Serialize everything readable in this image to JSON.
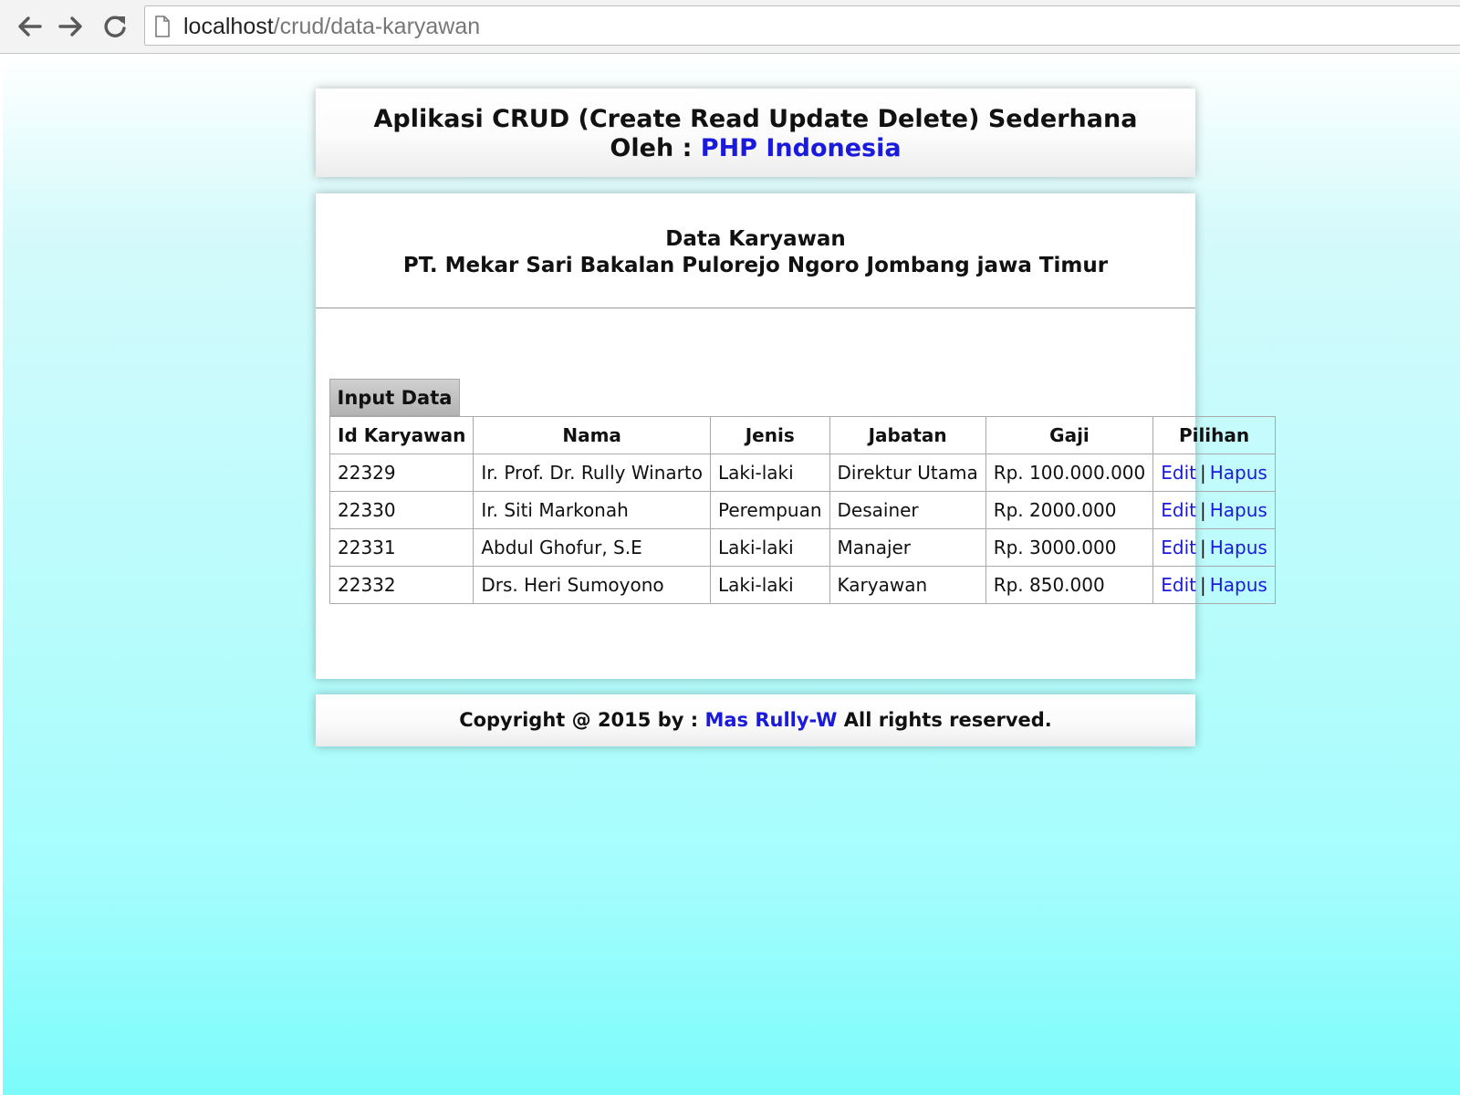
{
  "browser": {
    "url_host": "localhost",
    "url_path": "/crud/data-karyawan",
    "icons": [
      "back-arrow-icon",
      "forward-arrow-icon",
      "reload-icon",
      "page-icon"
    ]
  },
  "header": {
    "title": "Aplikasi CRUD (Create Read Update Delete) Sederhana",
    "by_label": "Oleh :",
    "by_link": "PHP Indonesia"
  },
  "content": {
    "title": "Data Karyawan",
    "subtitle": "PT. Mekar Sari Bakalan Pulorejo Ngoro Jombang jawa Timur",
    "input_button": "Input Data"
  },
  "table": {
    "headers": [
      "Id Karyawan",
      "Nama",
      "Jenis",
      "Jabatan",
      "Gaji",
      "Pilihan"
    ],
    "rows": [
      {
        "id": "22329",
        "nama": "Ir. Prof. Dr. Rully Winarto",
        "jenis": "Laki-laki",
        "jabatan": "Direktur Utama",
        "gaji": "Rp. 100.000.000"
      },
      {
        "id": "22330",
        "nama": "Ir. Siti Markonah",
        "jenis": "Perempuan",
        "jabatan": "Desainer",
        "gaji": "Rp. 2000.000"
      },
      {
        "id": "22331",
        "nama": "Abdul Ghofur, S.E",
        "jenis": "Laki-laki",
        "jabatan": "Manajer",
        "gaji": "Rp. 3000.000"
      },
      {
        "id": "22332",
        "nama": "Drs. Heri Sumoyono",
        "jenis": "Laki-laki",
        "jabatan": "Karyawan",
        "gaji": "Rp. 850.000"
      }
    ],
    "edit_label": "Edit",
    "separator": "|",
    "delete_label": "Hapus"
  },
  "footer": {
    "prefix": "Copyright @ 2015 by :",
    "author": "Mas Rully-W",
    "suffix": "All rights reserved."
  },
  "colors": {
    "link": "#1a1adc",
    "background_top": "#ffffff",
    "background_bottom": "#7cfbfb"
  }
}
